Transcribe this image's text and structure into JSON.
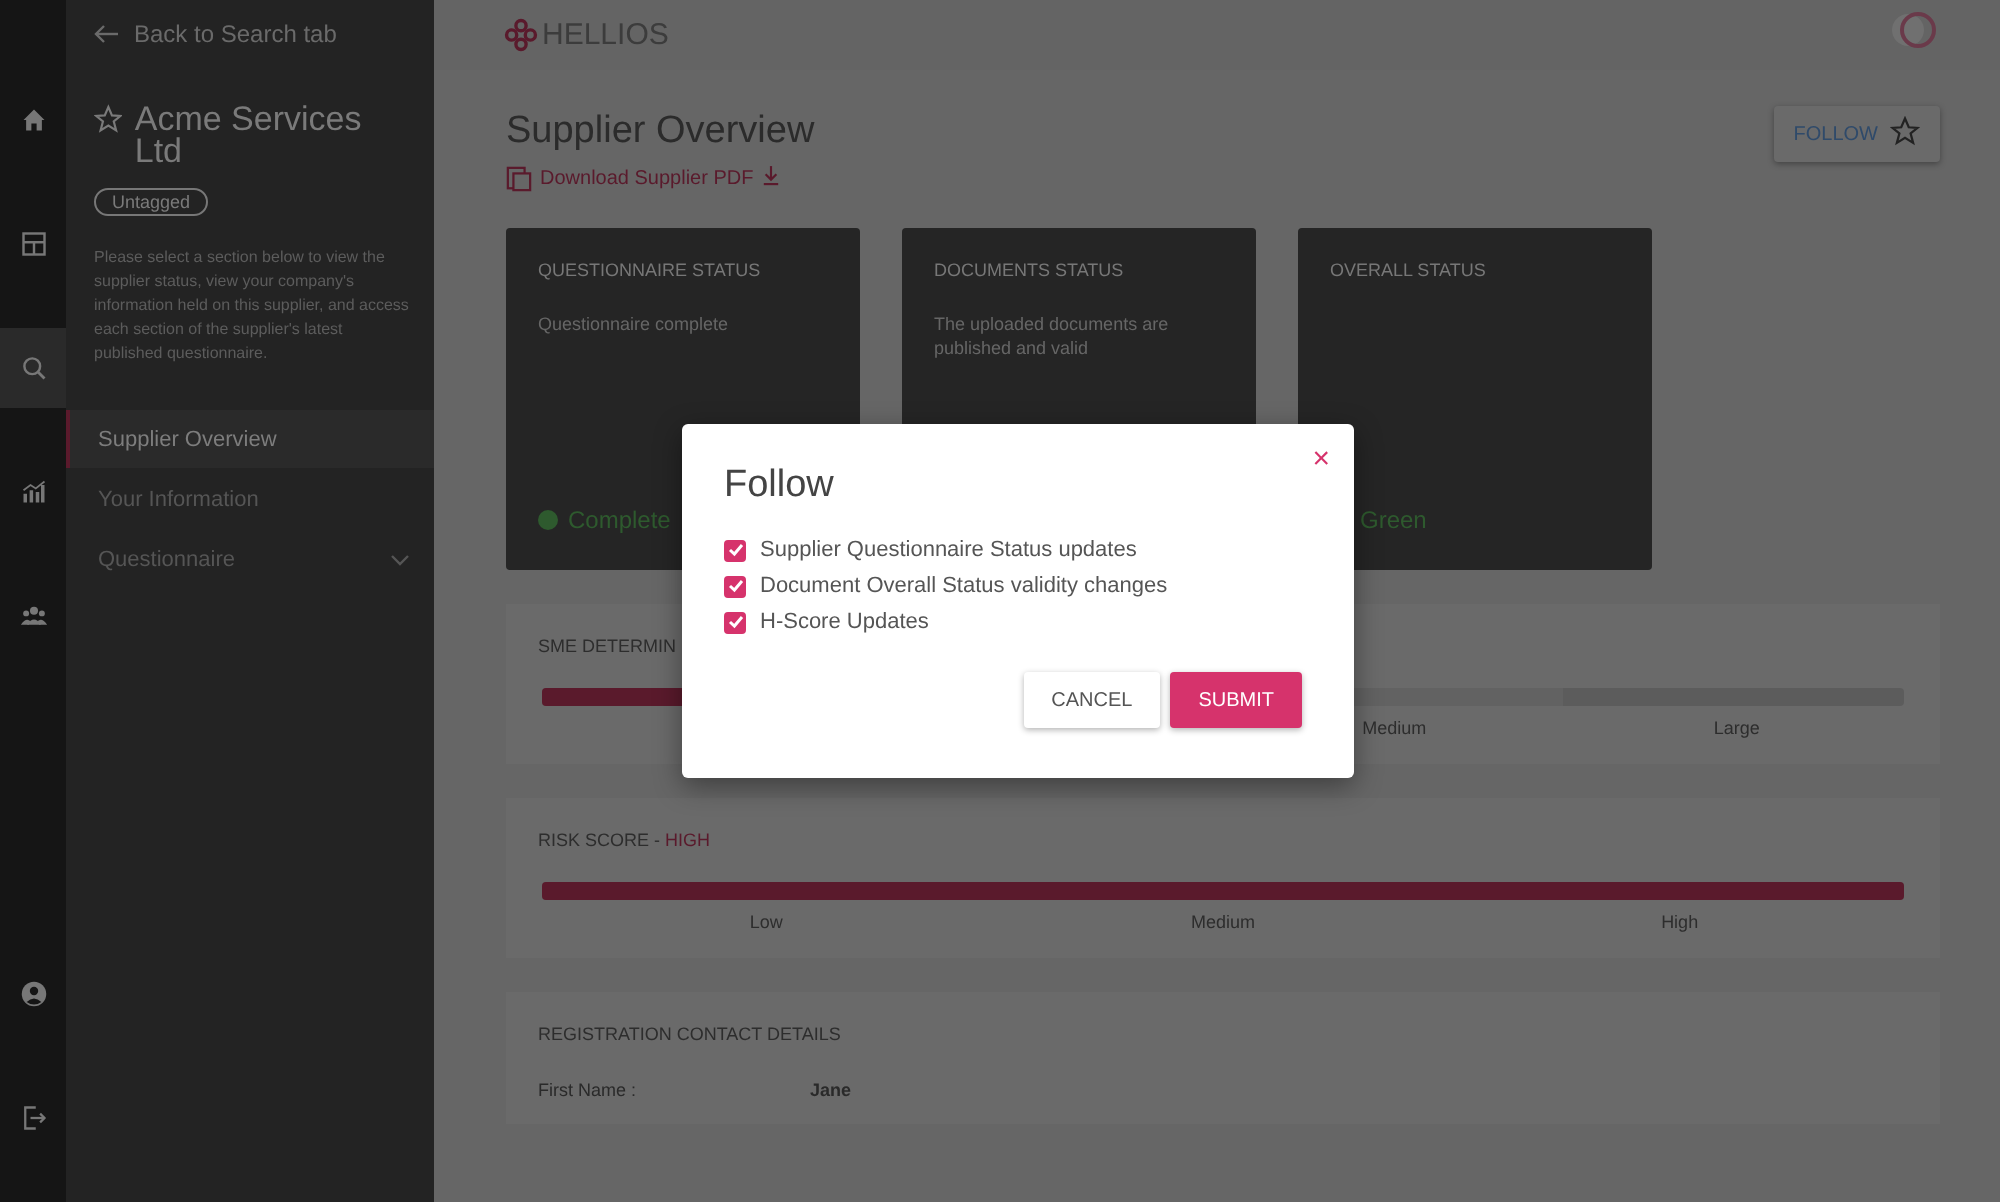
{
  "rail": [
    {
      "selected": false
    },
    {
      "selected": false
    },
    {
      "selected": true
    },
    {
      "selected": false
    },
    {
      "selected": false
    }
  ],
  "sidebar": {
    "back": "Back to Search tab",
    "supplier_name": "Acme Services Ltd",
    "tag": "Untagged",
    "description": "Please select a section below to view the supplier status, view your company's information held on this supplier, and access each section of the supplier's latest published questionnaire.",
    "items": [
      {
        "label": "Supplier Overview",
        "selected": true
      },
      {
        "label": "Your Information",
        "selected": false
      },
      {
        "label": "Questionnaire",
        "selected": false,
        "expanded": false
      }
    ]
  },
  "header": {
    "logo": "HELLIOS"
  },
  "page": {
    "title": "Supplier Overview",
    "download": "Download Supplier PDF",
    "follow": "FOLLOW"
  },
  "cards": [
    {
      "title": "QUESTIONNAIRE STATUS",
      "text": "Questionnaire complete",
      "status": "Complete",
      "color": "#2e5a2e"
    },
    {
      "title": "DOCUMENTS STATUS",
      "text": "The uploaded documents are published and valid"
    },
    {
      "title": "OVERALL STATUS",
      "status": "Green"
    }
  ],
  "sme": {
    "title": "SME DETERMIN",
    "level": 0.25,
    "labels": [
      "Medium",
      "Large"
    ]
  },
  "risk": {
    "title": "RISK SCORE - ",
    "value": "HIGH",
    "level": 1,
    "labels": [
      "Low",
      "Medium",
      "High"
    ]
  },
  "contact": {
    "title": "REGISTRATION CONTACT DETAILS",
    "fields": [
      {
        "label": "First Name :",
        "value": "Jane"
      }
    ]
  },
  "dialog": {
    "title": "Follow",
    "close": "×",
    "options": [
      {
        "label": "Supplier Questionnaire Status updates",
        "checked": true
      },
      {
        "label": "Document Overall Status validity changes",
        "checked": true
      },
      {
        "label": "H-Score Updates",
        "checked": true
      }
    ],
    "buttons": [
      {
        "label": "CANCEL",
        "kind": "secondary"
      },
      {
        "label": "SUBMIT",
        "kind": "primary"
      }
    ]
  }
}
